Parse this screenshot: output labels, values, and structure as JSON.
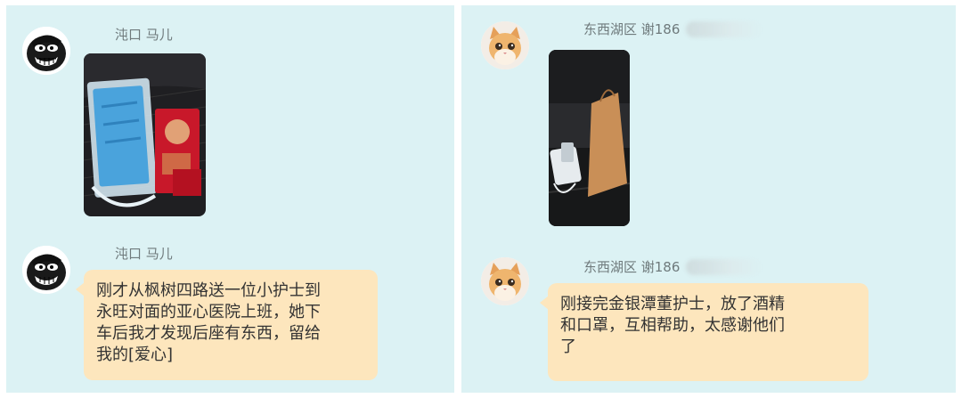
{
  "left_chat": {
    "messages": [
      {
        "sender": "沌口 马儿",
        "type": "image",
        "avatar_icon": "cartoon-man-avatar"
      },
      {
        "sender": "沌口 马儿",
        "type": "text",
        "avatar_icon": "cartoon-man-avatar",
        "lines": [
          "刚才从枫树四路送一位小护士到",
          "永旺对面的亚心医院上班，她下",
          "车后我才发现后座有东西，留给",
          "我的[爱心]"
        ]
      }
    ]
  },
  "right_chat": {
    "messages": [
      {
        "sender": "东西湖区 谢186",
        "type": "image",
        "avatar_icon": "kitten-avatar"
      },
      {
        "sender": "东西湖区 谢186",
        "type": "text",
        "avatar_icon": "kitten-avatar",
        "lines": [
          "刚接完金银潭董护士，放了酒精",
          "和口罩，互相帮助，太感谢他们",
          "了"
        ]
      }
    ]
  },
  "colors": {
    "panel": "#dcf2f4",
    "bubble": "#fde6bd",
    "sender_text": "#6f7a7c"
  }
}
